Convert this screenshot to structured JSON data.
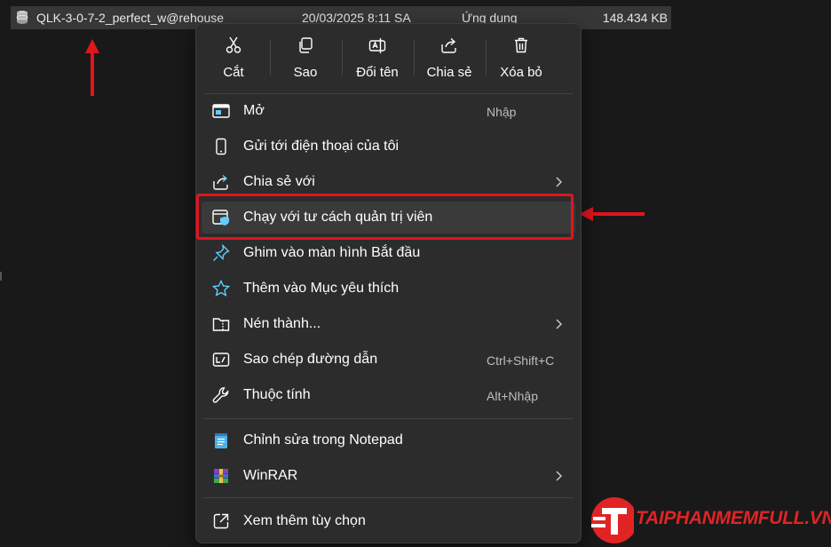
{
  "file": {
    "name": "QLK-3-0-7-2_perfect_w@rehouse",
    "date": "20/03/2025 8:11 SA",
    "type": "Ứng dụng",
    "size": "148.434 KB"
  },
  "quick_actions": [
    {
      "label": "Cắt",
      "icon": "scissors-icon"
    },
    {
      "label": "Sao",
      "icon": "copy-icon"
    },
    {
      "label": "Đổi tên",
      "icon": "rename-icon"
    },
    {
      "label": "Chia sẻ",
      "icon": "share-icon"
    },
    {
      "label": "Xóa bỏ",
      "icon": "trash-icon"
    }
  ],
  "menu_items": [
    {
      "label": "Mở",
      "shortcut": "Nhập",
      "icon": "open-window-icon"
    },
    {
      "label": "Gửi tới điện thoại của tôi",
      "icon": "phone-icon"
    },
    {
      "label": "Chia sẻ với",
      "icon": "share-with-icon",
      "submenu": true
    },
    {
      "label": "Chạy với tư cách quản trị viên",
      "icon": "admin-shield-icon",
      "highlighted": true
    },
    {
      "label": "Ghim vào màn hình Bắt đầu",
      "icon": "pin-icon"
    },
    {
      "label": "Thêm vào Mục yêu thích",
      "icon": "star-icon"
    },
    {
      "label": "Nén thành...",
      "icon": "zip-folder-icon",
      "submenu": true
    },
    {
      "label": "Sao chép đường dẫn",
      "shortcut": "Ctrl+Shift+C",
      "icon": "copy-path-icon"
    },
    {
      "label": "Thuộc tính",
      "shortcut": "Alt+Nhập",
      "icon": "wrench-icon"
    },
    {
      "label": "Chỉnh sửa trong Notepad",
      "icon": "notepad-icon"
    },
    {
      "label": "WinRAR",
      "icon": "winrar-icon",
      "submenu": true
    },
    {
      "label": "Xem thêm tùy chọn",
      "icon": "more-options-icon"
    }
  ],
  "watermark": {
    "text": "TAIPHANMEMFULL.VN"
  },
  "colors": {
    "menu_bg": "#2c2c2c",
    "highlight_box": "#e2141e",
    "accent_blue": "#60cdff",
    "watermark": "#e02424"
  }
}
